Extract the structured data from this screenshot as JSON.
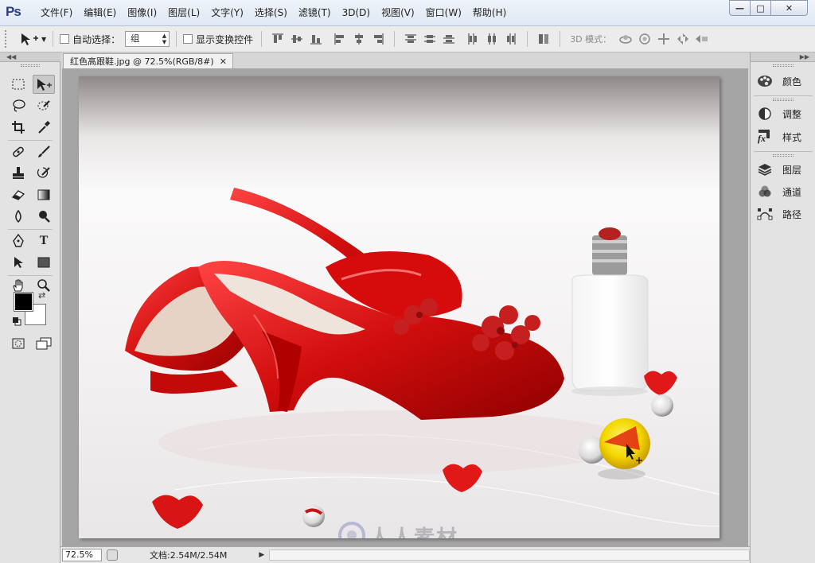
{
  "app": {
    "logo": "Ps"
  },
  "menu": [
    "文件(F)",
    "编辑(E)",
    "图像(I)",
    "图层(L)",
    "文字(Y)",
    "选择(S)",
    "滤镜(T)",
    "3D(D)",
    "视图(V)",
    "窗口(W)",
    "帮助(H)"
  ],
  "window_controls": {
    "minimize": "—",
    "maximize": "□",
    "close": "✕"
  },
  "options": {
    "auto_select_label": "自动选择：",
    "auto_select_checked": false,
    "auto_select_target": "组",
    "show_transform_label": "显示变换控件",
    "show_transform_checked": false,
    "mode_3d_label": "3D 模式："
  },
  "document": {
    "tab_title": "红色高跟鞋.jpg @ 72.5%(RGB/8#)",
    "close_glyph": "✕"
  },
  "status": {
    "zoom": "72.5%",
    "doc_size": "文档:2.54M/2.54M",
    "arrow": "▶"
  },
  "tools": {
    "fg_color": "#000000",
    "bg_color": "#ffffff",
    "type_glyph": "T"
  },
  "right_panels": {
    "group1": [
      {
        "label": "颜色",
        "icon": "palette-icon"
      }
    ],
    "group2": [
      {
        "label": "调整",
        "icon": "adjustments-icon"
      },
      {
        "label": "样式",
        "icon": "styles-fx-icon"
      }
    ],
    "group3": [
      {
        "label": "图层",
        "icon": "layers-icon"
      },
      {
        "label": "通道",
        "icon": "channels-icon"
      },
      {
        "label": "路径",
        "icon": "paths-icon"
      }
    ],
    "fx_glyph": "fx"
  },
  "watermark": {
    "text": "人人素材"
  },
  "colors": {
    "accent": "#d81b1b",
    "ps_logo": "#2a3c86"
  }
}
